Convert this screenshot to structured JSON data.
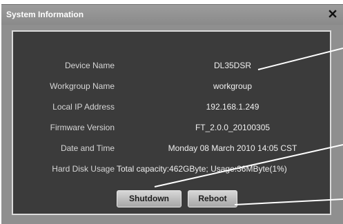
{
  "window": {
    "title": "System Information",
    "close_symbol": "×"
  },
  "info": {
    "rows": [
      {
        "label": "Device Name",
        "value": "DL35DSR"
      },
      {
        "label": "Workgroup Name",
        "value": "workgroup"
      },
      {
        "label": "Local IP Address",
        "value": "192.168.1.249"
      },
      {
        "label": "Firmware Version",
        "value": "FT_2.0.0_20100305"
      },
      {
        "label": "Date and Time",
        "value": "Monday 08 March 2010 14:05 CST"
      },
      {
        "label": "Hard Disk Usage",
        "value": "Total capacity:462GByte; Usage:36MByte(1%)"
      }
    ]
  },
  "buttons": {
    "shutdown": "Shutdown",
    "reboot": "Reboot"
  },
  "icons": {
    "close": "close-icon"
  },
  "colors": {
    "window_bg": "#8f8f8f",
    "panel_bg": "#3b3b3b",
    "panel_border": "#dcdcdc",
    "title_text": "#ffffff",
    "callout_line": "#ffffff"
  }
}
